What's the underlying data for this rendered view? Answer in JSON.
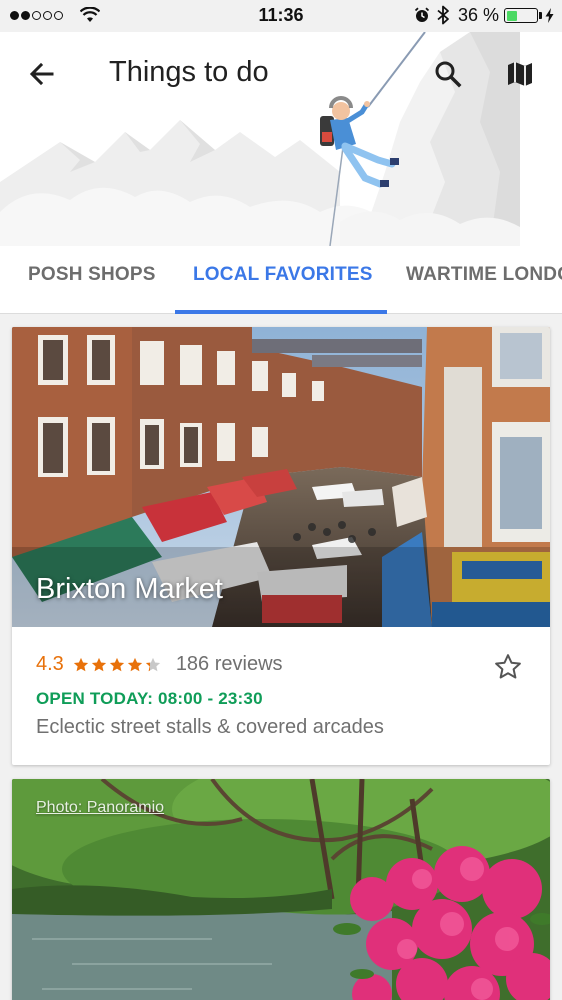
{
  "status_bar": {
    "time": "11:36",
    "battery_percent": "36 %",
    "battery_level": 0.36,
    "signal_bars_filled": 2,
    "signal_bars_total": 5
  },
  "header": {
    "title": "Things to do",
    "back_icon": "arrow-left-icon",
    "search_icon": "search-icon",
    "map_icon": "map-icon"
  },
  "tabs": [
    {
      "label": "POSH SHOPS",
      "active": false
    },
    {
      "label": "LOCAL FAVORITES",
      "active": true
    },
    {
      "label": "WARTIME LONDON",
      "active": false
    }
  ],
  "cards": [
    {
      "title": "Brixton Market",
      "rating": "4.3",
      "stars": 4.3,
      "reviews": "186 reviews",
      "hours": "OPEN TODAY: 08:00 - 23:30",
      "description": "Eclectic street stalls & covered arcades",
      "save_icon": "star-outline-icon"
    },
    {
      "photo_credit": "Photo: Panoramio"
    }
  ],
  "colors": {
    "accent": "#3b78e7",
    "rating": "#e8710a",
    "open": "#0f9d58",
    "battery": "#4cd964"
  }
}
